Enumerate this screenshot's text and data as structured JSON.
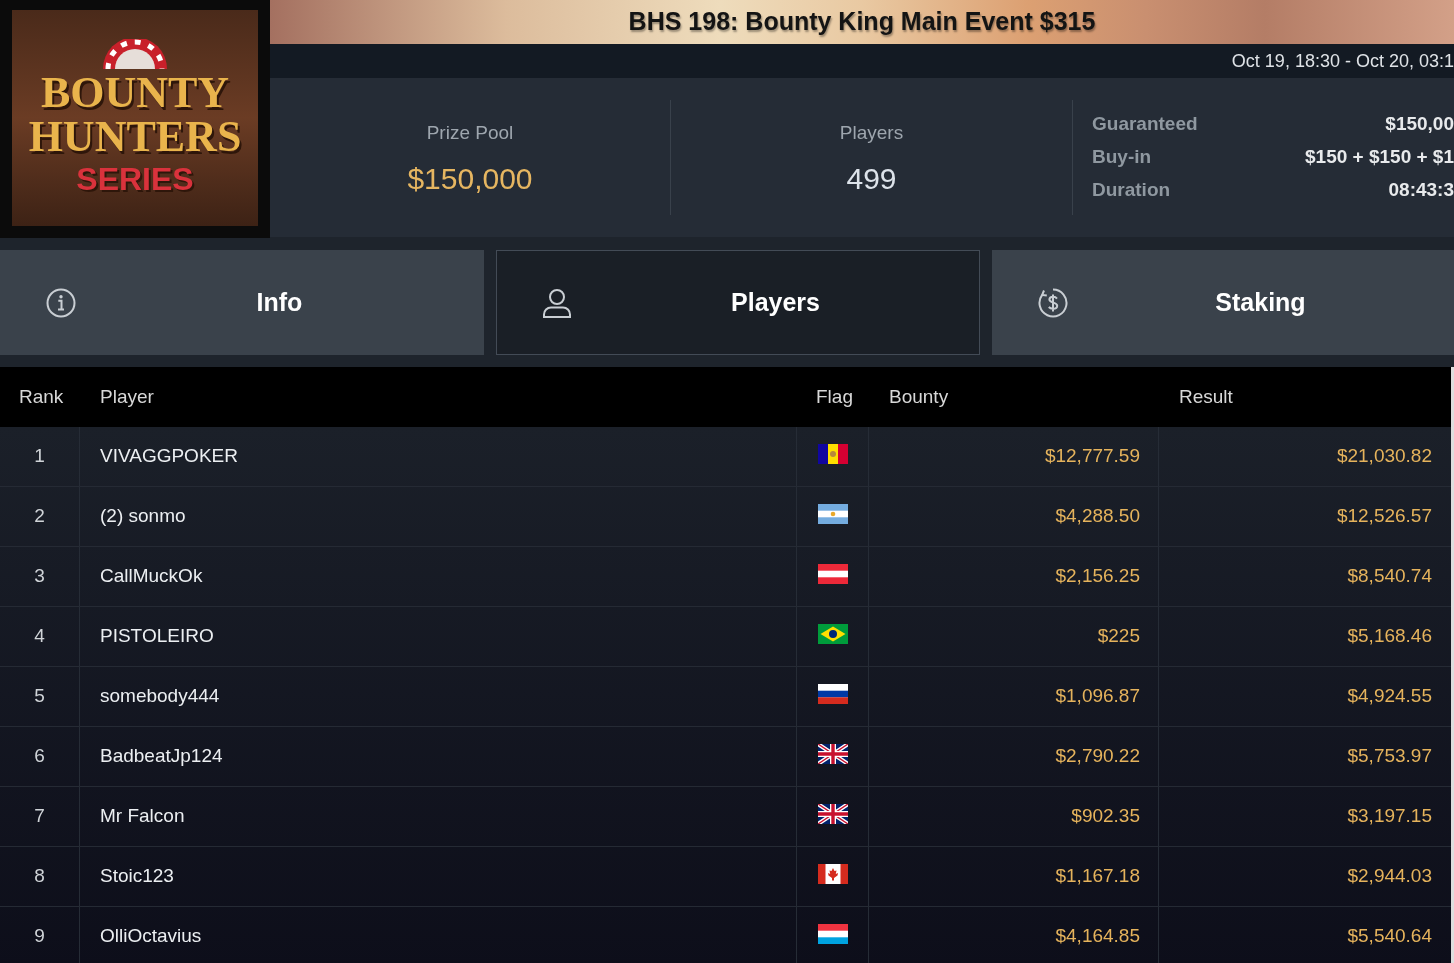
{
  "logo": {
    "title_lines": [
      "BOUNTY",
      "HUNTERS"
    ],
    "subtitle": "SERIES"
  },
  "title": "BHS 198: Bounty King Main Event $315",
  "schedule": "Oct 19, 18:30 - Oct 20, 03:1",
  "stats": [
    {
      "label": "Prize Pool",
      "value": "$150,000",
      "kind": "money"
    },
    {
      "label": "Players",
      "value": "499",
      "kind": "count"
    }
  ],
  "details": [
    {
      "label": "Guaranteed",
      "value": "$150,00"
    },
    {
      "label": "Buy-in",
      "value": "$150 + $150 + $1"
    },
    {
      "label": "Duration",
      "value": "08:43:3"
    }
  ],
  "tabs": [
    {
      "label": "Info",
      "selected": false
    },
    {
      "label": "Players",
      "selected": true
    },
    {
      "label": "Staking",
      "selected": false
    }
  ],
  "table": {
    "columns": [
      "Rank",
      "Player",
      "Flag",
      "Bounty",
      "Result"
    ],
    "rows": [
      {
        "rank": "1",
        "player": "VIVAGGPOKER",
        "flag": {
          "kind": "andorra"
        },
        "bounty": "$12,777.59",
        "result": "$21,030.82"
      },
      {
        "rank": "2",
        "player": "(2) sonmo",
        "flag": {
          "kind": "argentina"
        },
        "bounty": "$4,288.50",
        "result": "$12,526.57"
      },
      {
        "rank": "3",
        "player": "CallMuckOk",
        "flag": {
          "kind": "austria"
        },
        "bounty": "$2,156.25",
        "result": "$8,540.74"
      },
      {
        "rank": "4",
        "player": "PISTOLEIRO",
        "flag": {
          "kind": "brazil"
        },
        "bounty": "$225",
        "result": "$5,168.46"
      },
      {
        "rank": "5",
        "player": "somebody444",
        "flag": {
          "kind": "russia"
        },
        "bounty": "$1,096.87",
        "result": "$4,924.55"
      },
      {
        "rank": "6",
        "player": "BadbeatJp124",
        "flag": {
          "kind": "uk"
        },
        "bounty": "$2,790.22",
        "result": "$5,753.97"
      },
      {
        "rank": "7",
        "player": "Mr Falcon",
        "flag": {
          "kind": "uk"
        },
        "bounty": "$902.35",
        "result": "$3,197.15"
      },
      {
        "rank": "8",
        "player": "Stoic123",
        "flag": {
          "kind": "canada"
        },
        "bounty": "$1,167.18",
        "result": "$2,944.03"
      },
      {
        "rank": "9",
        "player": "OlliOctavius",
        "flag": {
          "kind": "luxembourg"
        },
        "bounty": "$4,164.85",
        "result": "$5,540.64"
      }
    ]
  }
}
